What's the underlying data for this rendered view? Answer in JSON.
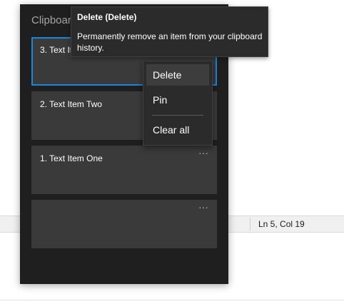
{
  "editor": {
    "status_position": "Ln 5, Col 19"
  },
  "clipboard": {
    "title": "Clipboard",
    "more_glyph": "···",
    "items": [
      {
        "label": "3. Text Item Three"
      },
      {
        "label": "2. Text Item Two"
      },
      {
        "label": "1. Text Item One"
      },
      {
        "label": ""
      }
    ]
  },
  "context_menu": {
    "items": [
      {
        "label": "Delete"
      },
      {
        "label": "Pin"
      },
      {
        "label": "Clear all"
      }
    ]
  },
  "tooltip": {
    "title": "Delete (Delete)",
    "body": "Permanently remove an item from your clipboard history."
  },
  "colors": {
    "accent": "#1a86d9",
    "panel_bg": "#1f1f1f",
    "item_bg": "#3a3a3a"
  }
}
